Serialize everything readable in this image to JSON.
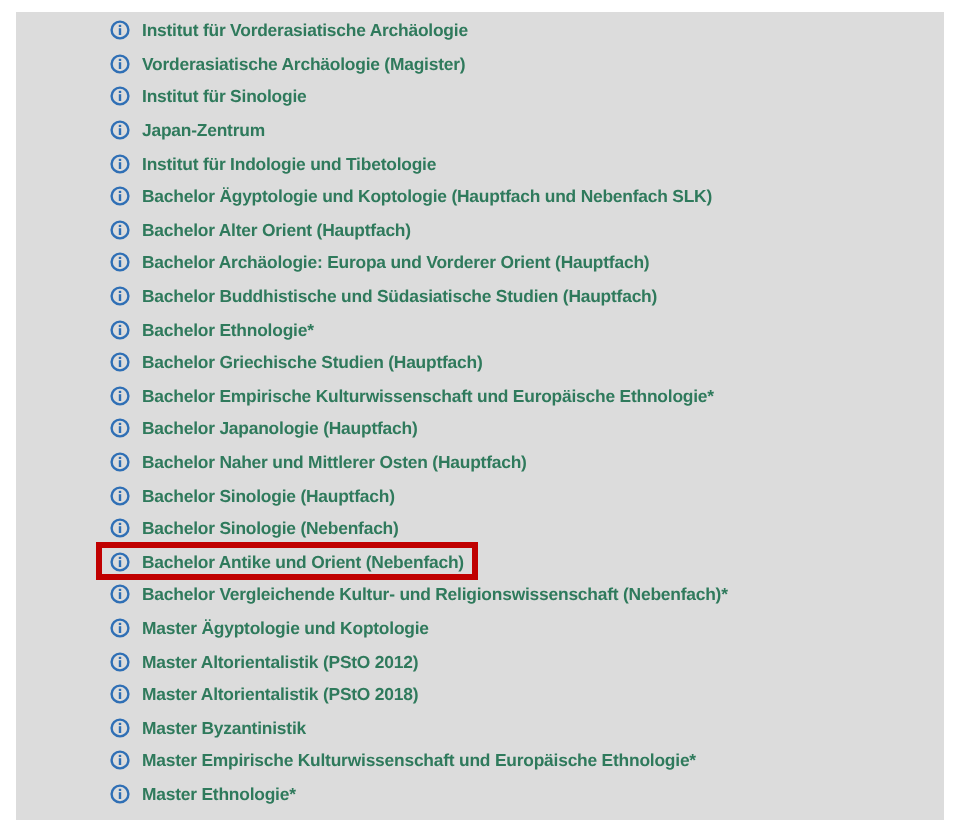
{
  "links": [
    {
      "label": "Institut für Vorderasiatische Archäologie",
      "highlighted": false
    },
    {
      "label": "Vorderasiatische Archäologie (Magister)",
      "highlighted": false
    },
    {
      "label": "Institut für Sinologie",
      "highlighted": false
    },
    {
      "label": "Japan-Zentrum",
      "highlighted": false
    },
    {
      "label": "Institut für Indologie und Tibetologie",
      "highlighted": false
    },
    {
      "label": "Bachelor Ägyptologie und Koptologie (Hauptfach und Nebenfach SLK)",
      "highlighted": false
    },
    {
      "label": "Bachelor Alter Orient (Hauptfach)",
      "highlighted": false
    },
    {
      "label": "Bachelor Archäologie: Europa und Vorderer Orient (Hauptfach)",
      "highlighted": false
    },
    {
      "label": "Bachelor Buddhistische und Südasiatische Studien (Hauptfach)",
      "highlighted": false
    },
    {
      "label": "Bachelor Ethnologie*",
      "highlighted": false
    },
    {
      "label": "Bachelor Griechische Studien (Hauptfach)",
      "highlighted": false
    },
    {
      "label": "Bachelor Empirische Kulturwissenschaft und Europäische Ethnologie*",
      "highlighted": false
    },
    {
      "label": "Bachelor Japanologie (Hauptfach)",
      "highlighted": false
    },
    {
      "label": "Bachelor Naher und Mittlerer Osten (Hauptfach)",
      "highlighted": false
    },
    {
      "label": "Bachelor Sinologie (Hauptfach)",
      "highlighted": false
    },
    {
      "label": "Bachelor Sinologie (Nebenfach)",
      "highlighted": false
    },
    {
      "label": "Bachelor Antike und Orient (Nebenfach)",
      "highlighted": true
    },
    {
      "label": "Bachelor Vergleichende Kultur- und Religionswissenschaft (Nebenfach)*",
      "highlighted": false
    },
    {
      "label": "Master Ägyptologie und Koptologie",
      "highlighted": false
    },
    {
      "label": "Master Altorientalistik (PStO 2012)",
      "highlighted": false
    },
    {
      "label": "Master Altorientalistik (PStO 2018)",
      "highlighted": false
    },
    {
      "label": "Master Byzantinistik",
      "highlighted": false
    },
    {
      "label": "Master Empirische Kulturwissenschaft und Europäische Ethnologie*",
      "highlighted": false
    },
    {
      "label": "Master Ethnologie*",
      "highlighted": false
    }
  ]
}
